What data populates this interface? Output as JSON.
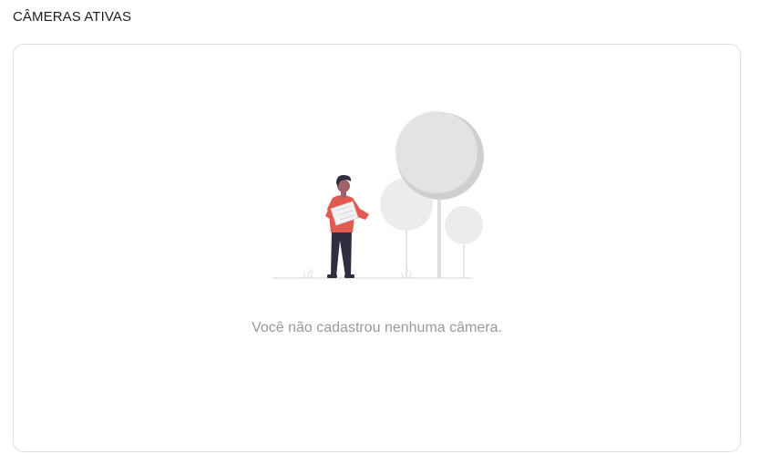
{
  "section": {
    "title": "CÂMERAS ATIVAS"
  },
  "empty_state": {
    "message": "Você não cadastrou nenhuma câmera.",
    "illustration": "person-holding-map-with-trees-illustration",
    "colors": {
      "person_shirt": "#e05a52",
      "person_pants": "#2f2e41",
      "tree_light": "#ececec",
      "tree_dark": "#cfcfcf",
      "ground": "#dcdcdc"
    }
  },
  "colors": {
    "title_text": "#1e1e1e",
    "message_text": "#9a9a9a",
    "card_border": "#dedede"
  }
}
